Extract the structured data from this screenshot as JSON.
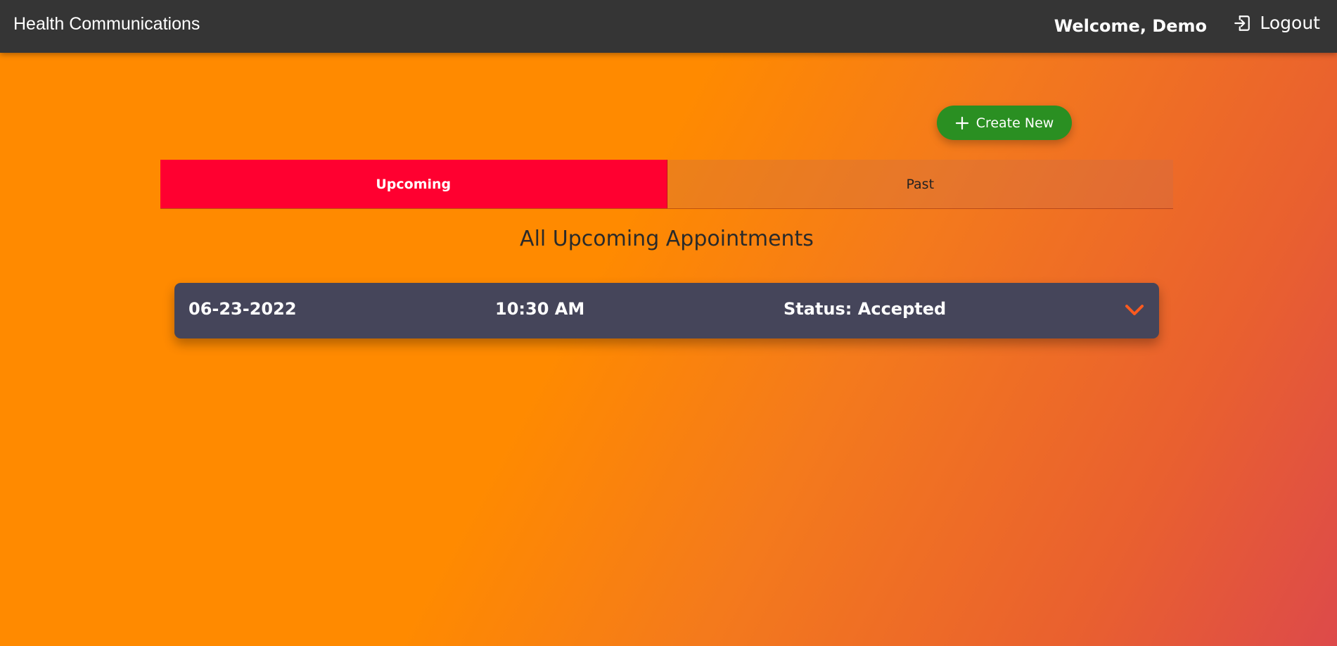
{
  "app": {
    "title": "Health Communications"
  },
  "header": {
    "welcome_text": "Welcome, Demo",
    "logout_label": "Logout",
    "logout_icon": "logout-icon"
  },
  "actions": {
    "create_new_label": "Create New",
    "create_new_icon": "plus-icon"
  },
  "tabs": [
    {
      "label": "Upcoming",
      "active": true
    },
    {
      "label": "Past",
      "active": false
    }
  ],
  "main": {
    "section_title": "All Upcoming Appointments"
  },
  "appointments": [
    {
      "date": "06-23-2022",
      "time": "10:30 AM",
      "status_label": "Status:",
      "status_value": "Accepted",
      "expand_icon": "chevron-down-icon"
    }
  ],
  "colors": {
    "topbar": "#353535",
    "active_tab": "#ff0030",
    "create_button": "#2a8f22",
    "card": "#45455a",
    "chevron": "#ff5a1f",
    "gradient_start": "#ff8a00",
    "gradient_end": "#dd4a4a"
  }
}
